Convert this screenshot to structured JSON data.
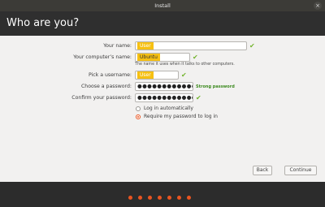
{
  "window": {
    "title": "Install",
    "close_glyph": "×"
  },
  "page": {
    "heading": "Who are you?"
  },
  "form": {
    "name": {
      "label": "Your name:",
      "value": "User"
    },
    "computer": {
      "label": "Your computer’s name:",
      "value": "Ubuntu",
      "hint": "The name it uses when it talks to other computers."
    },
    "username": {
      "label": "Pick a username:",
      "value": "User"
    },
    "password": {
      "label": "Choose a password:",
      "value": "●●●●●●●●●●●●●●",
      "strength": "Strong password"
    },
    "confirm": {
      "label": "Confirm your password:",
      "value": "●●●●●●●●●●●●●●"
    },
    "login_options": [
      {
        "label": "Log in automatically",
        "selected": false
      },
      {
        "label": "Require my password to log in",
        "selected": true
      }
    ]
  },
  "buttons": {
    "back": "Back",
    "continue": "Continue"
  },
  "icons": {
    "check": "✔",
    "check_name": "check-icon"
  },
  "colors": {
    "accent": "#e95420",
    "highlight": "#f6c012",
    "ok": "#73b42e"
  },
  "progress": {
    "steps": 7
  }
}
